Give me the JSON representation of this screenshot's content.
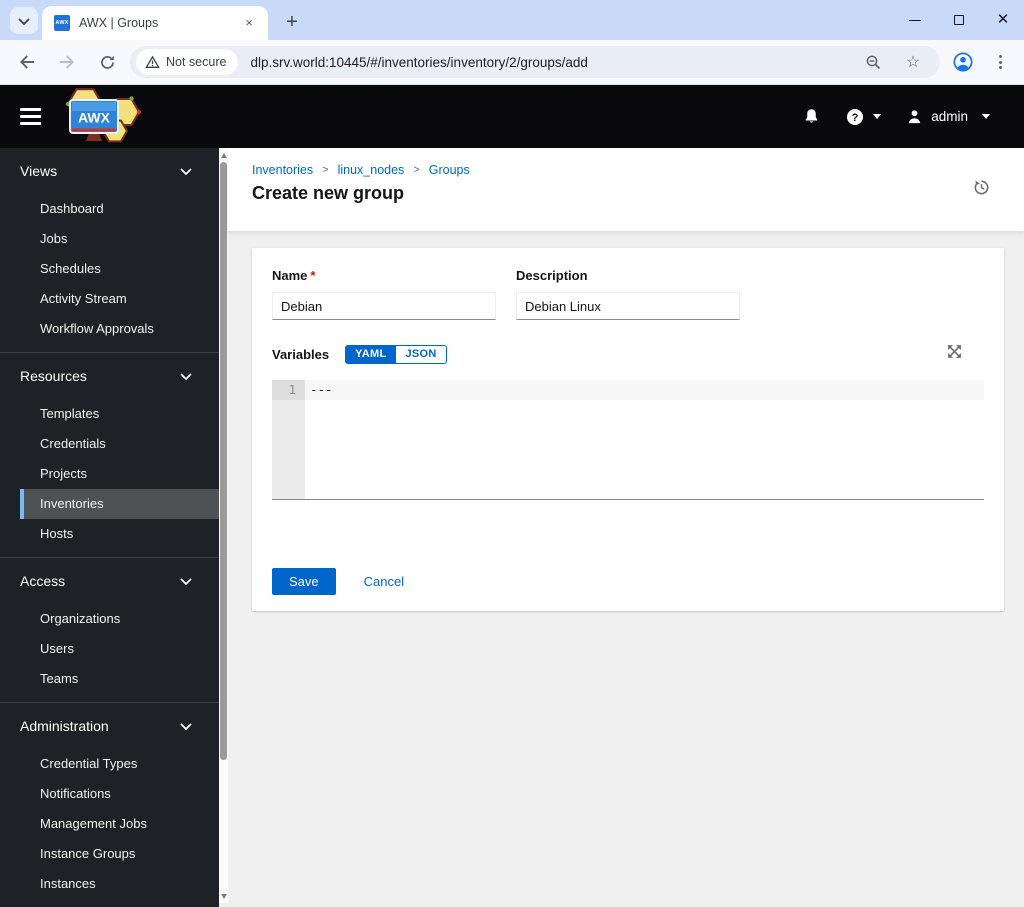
{
  "browser": {
    "tab": {
      "title": "AWX | Groups",
      "favicon_text": "AWX"
    },
    "address": {
      "security_label": "Not secure",
      "url": "dlp.srv.world:10445/#/inventories/inventory/2/groups/add"
    },
    "new_tab_glyph": "+",
    "close_tab_glyph": "×",
    "close_window_glyph": "✕"
  },
  "header": {
    "logo_text": "AWX",
    "user_label": "admin"
  },
  "sidebar": {
    "sections": [
      {
        "label": "Views",
        "items": [
          "Dashboard",
          "Jobs",
          "Schedules",
          "Activity Stream",
          "Workflow Approvals"
        ]
      },
      {
        "label": "Resources",
        "items": [
          "Templates",
          "Credentials",
          "Projects",
          "Inventories",
          "Hosts"
        ],
        "selected_item": "Inventories"
      },
      {
        "label": "Access",
        "items": [
          "Organizations",
          "Users",
          "Teams"
        ]
      },
      {
        "label": "Administration",
        "items": [
          "Credential Types",
          "Notifications",
          "Management Jobs",
          "Instance Groups",
          "Instances"
        ]
      }
    ]
  },
  "main": {
    "breadcrumb": [
      "Inventories",
      "linux_nodes",
      "Groups"
    ],
    "title": "Create new group",
    "form": {
      "name_label": "Name",
      "required_marker": "*",
      "name_value": "Debian",
      "description_label": "Description",
      "description_value": "Debian Linux",
      "variables_label": "Variables",
      "yaml_label": "YAML",
      "json_label": "JSON",
      "editor_line_number": "1",
      "variables_value": "---",
      "save_label": "Save",
      "cancel_label": "Cancel"
    }
  },
  "colors": {
    "accent": "#0066cc",
    "selected_indicator": "#73bcf7",
    "required_asterisk": "#c9190b",
    "header_bg": "#0a0a0c",
    "sidebar_bg": "#1e2125"
  }
}
